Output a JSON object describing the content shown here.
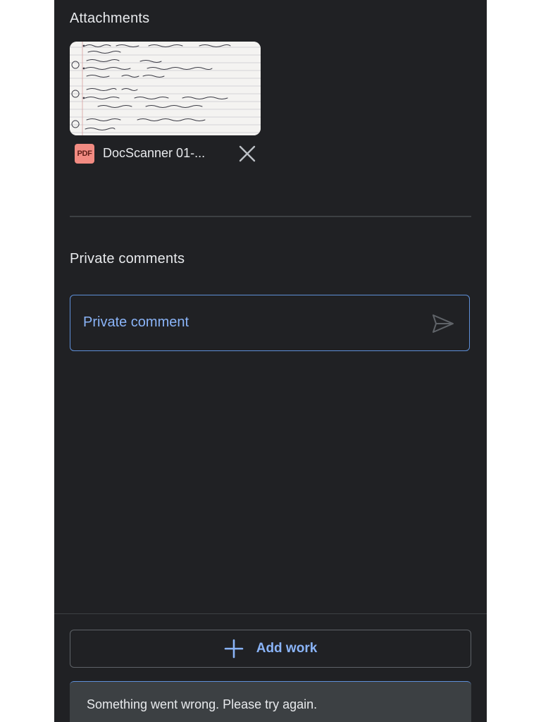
{
  "attachments": {
    "title": "Attachments",
    "file": {
      "name": "DocScanner 01-...",
      "type_badge": "PDF",
      "icon": "pdf-icon",
      "remove_icon": "close-icon"
    }
  },
  "private_comments": {
    "title": "Private comments",
    "placeholder": "Private comment",
    "send_icon": "send-icon"
  },
  "actions": {
    "add_work_label": "Add work",
    "add_icon": "plus-icon"
  },
  "snackbar": {
    "message": "Something went wrong. Please try again."
  },
  "colors": {
    "background": "#202124",
    "accent": "#8ab4f8",
    "text": "#e8eaed",
    "pdf_badge": "#f28b82"
  }
}
